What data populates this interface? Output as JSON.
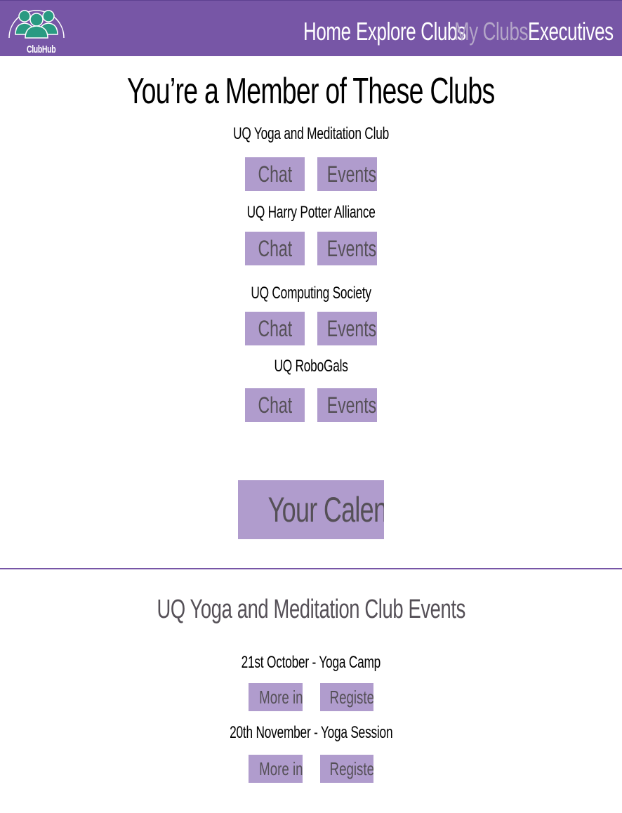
{
  "brand": {
    "logo_text": "ClubHub",
    "color": "#7756a6",
    "icon": "people-group-icon"
  },
  "nav": {
    "items": [
      {
        "label": "Home",
        "active": false
      },
      {
        "label": "Explore Clubs",
        "active": false
      },
      {
        "label": "My Clubs",
        "active": true
      },
      {
        "label": "Executives",
        "active": false
      }
    ]
  },
  "main": {
    "title": "You’re a Member of These Clubs",
    "clubs": [
      {
        "name": "UQ Yoga and Meditation Club",
        "chat_label": "Chat",
        "events_label": "Events"
      },
      {
        "name": "UQ Harry Potter Alliance",
        "chat_label": "Chat",
        "events_label": "Events"
      },
      {
        "name": "UQ Computing Society",
        "chat_label": "Chat",
        "events_label": "Events"
      },
      {
        "name": "UQ RoboGals",
        "chat_label": "Chat",
        "events_label": "Events"
      }
    ],
    "calendar_label": "Your Calendar"
  },
  "events_section": {
    "title": "UQ Yoga and Meditation Club Events",
    "events": [
      {
        "name": "21st October - Yoga Camp",
        "more_info_label": "More info",
        "register_label": "Register"
      },
      {
        "name": "20th November - Yoga Session",
        "more_info_label": "More info",
        "register_label": "Register"
      }
    ]
  },
  "colors": {
    "nav_bg": "#7756a6",
    "button_bg": "#b09ccd",
    "button_text": "#555057",
    "active_nav": "#b4a6c8",
    "logo_icon": "#2a9a82"
  }
}
